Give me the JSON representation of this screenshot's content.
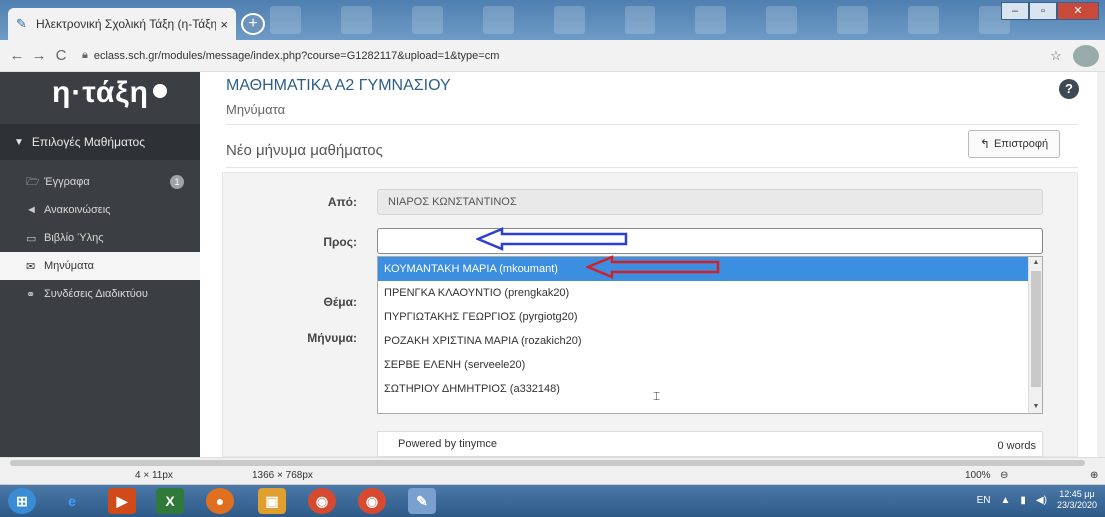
{
  "browser": {
    "tab_title": "Ηλεκτρονική Σχολική Τάξη (η-Τάξη)",
    "tab_close": "×",
    "new_tab": "+",
    "url": "eclass.sch.gr/modules/message/index.php?course=G1282117&upload=1&type=cm",
    "back": "←",
    "forward": "→",
    "reload": "C",
    "star": "☆"
  },
  "sidebar": {
    "logo": "η·τάξη",
    "header": "Επιλογές Μαθήματος",
    "items": [
      {
        "label": "Έγγραφα",
        "icon": "folder-icon",
        "badge": "1"
      },
      {
        "label": "Ανακοινώσεις",
        "icon": "megaphone-icon"
      },
      {
        "label": "Βιβλίο Ύλης",
        "icon": "calendar-icon"
      },
      {
        "label": "Μηνύματα",
        "icon": "envelope-icon",
        "active": true
      },
      {
        "label": "Συνδέσεις Διαδικτύου",
        "icon": "link-icon"
      }
    ]
  },
  "main": {
    "course_title": "ΜΑΘΗΜΑΤΙΚΑ Α2 ΓΥΜΝΑΣΙΟΥ",
    "subpage": "Μηνύματα",
    "help": "?",
    "section_title": "Νέο μήνυμα μαθήματος",
    "back_button": "Επιστροφή"
  },
  "form": {
    "from_label": "Από:",
    "from_value": "ΝΙΑΡΟΣ ΚΩΝΣΤΑΝΤΙΝΟΣ",
    "to_label": "Προς:",
    "subject_label": "Θέμα:",
    "message_label": "Μήνυμα:",
    "recipients": [
      "ΚΟΥΜΑΝΤΑΚΗ ΜΑΡΙΑ (mkoumant)",
      "ΠΡΕΝΓΚΑ ΚΛΑΟΥΝΤΙΟ (prengkak20)",
      "ΠΥΡΓΙΩΤΑΚΗΣ ΓΕΩΡΓΙΟΣ (pyrgiotg20)",
      "ΡΟΖΑΚΗ ΧΡΙΣΤΙΝΑ ΜΑΡΙΑ (rozakich20)",
      "ΣΕΡΒΕ ΕΛΕΝΗ (serveele20)",
      "ΣΩΤΗΡΙΟΥ ΔΗΜΗΤΡΙΟΣ (a332148)"
    ],
    "editor_powered": "Powered by tinymce",
    "editor_words": "0 words"
  },
  "statusbar": {
    "selection_size": "4 × 11px",
    "screen_size": "1366 × 768px",
    "zoom": "100%"
  },
  "taskbar": {
    "lang": "EN",
    "time": "12:45 μμ",
    "date": "23/3/2020"
  },
  "colors": {
    "sidebar_bg": "#3b3f43",
    "selected_option": "#3b8ee0",
    "course_title": "#2d5f88",
    "blue_arrow": "#2f3fd0",
    "red_arrow": "#d0202a"
  }
}
